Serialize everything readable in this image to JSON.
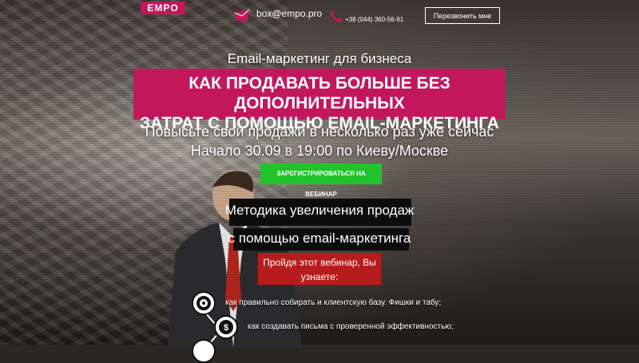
{
  "header": {
    "logo_text": "EMPO",
    "email": "box@empo.pro",
    "phone": "+38 (044) 360-56-91",
    "callback_label": "Перезвонить мне"
  },
  "hero": {
    "subtitle": "Email-маркетинг для бизнеса",
    "headline_line1": "КАК ПРОДАВАТЬ БОЛЬШЕ БЕЗ ДОПОЛНИТЕЛЬНЫХ",
    "headline_line2": "ЗАТРАТ С ПОМОЩЬЮ EMAIL-МАРКЕТИНГА",
    "promo_line1": "Повысьте свои продажи в несколько раз уже сейчас",
    "promo_line2": "Начало 30.09 в 19:00 по Киеву/Москве",
    "register_label": "ЗАРЕГИСТРИРОВАТЬСЯ НА ВЕБИНАР"
  },
  "method": {
    "line1": "Методика увеличения продаж",
    "line2": "с помощью email-маркетинга"
  },
  "learn": {
    "line1": "Пройдя этот вебинар, Вы",
    "line2": "узнаете:"
  },
  "benefits": [
    {
      "icon": "target-icon",
      "text": "как правильно собирать и клиентскую базу. Фишки и табу;"
    },
    {
      "icon": "dollar-icon",
      "text": "как создавать письма с проверенной эффективностью;"
    }
  ],
  "colors": {
    "accent": "#c2185b",
    "cta": "#22c32a",
    "learn_box": "#b71c1c"
  }
}
